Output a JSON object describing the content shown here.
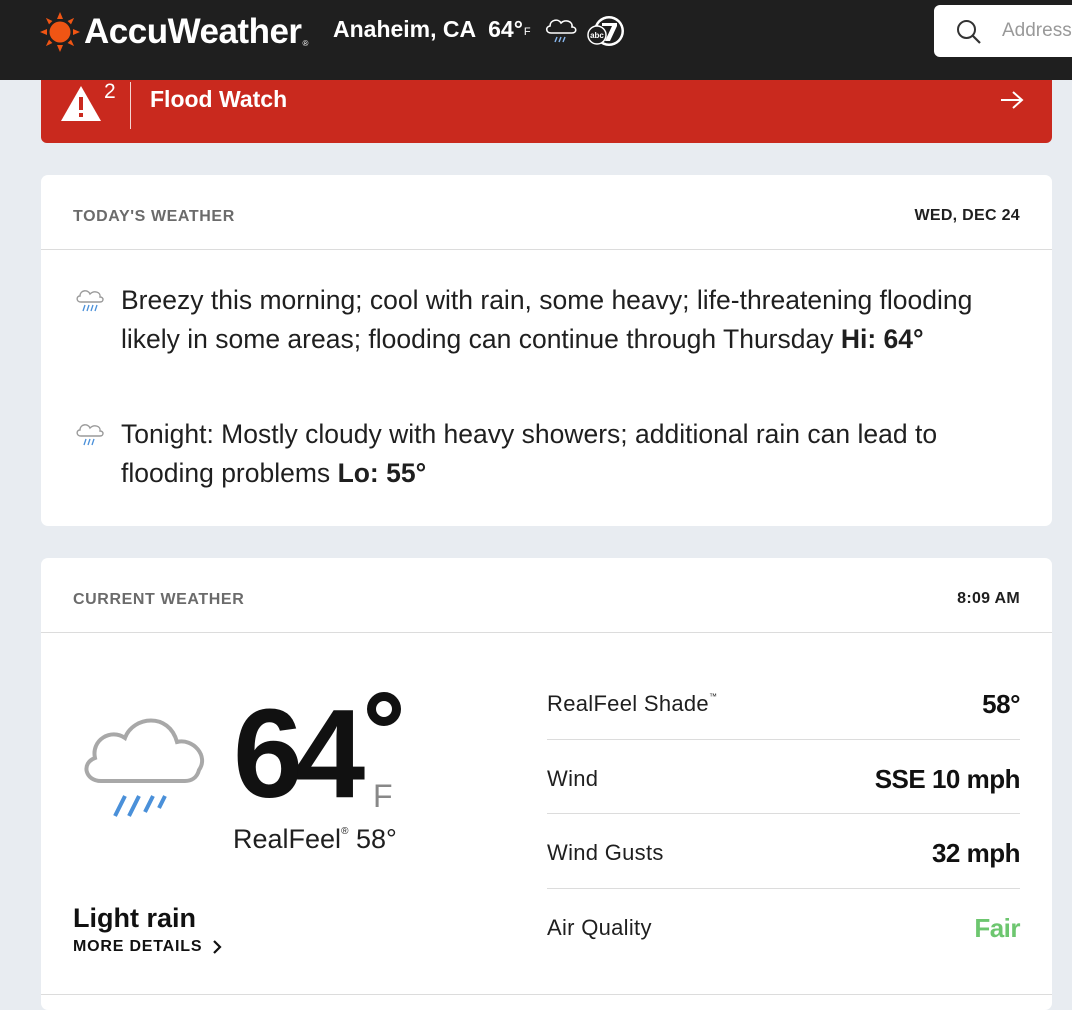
{
  "header": {
    "brand": "AccuWeather",
    "location": "Anaheim, CA",
    "temp": "64°",
    "temp_unit": "F",
    "weather_icon": "rain-icon",
    "partner_logo": "abc7-logo",
    "search_placeholder": "Address"
  },
  "alert": {
    "count": "2",
    "title": "Flood Watch",
    "color": "#c9291e"
  },
  "today": {
    "header": "TODAY'S WEATHER",
    "date": "WED, DEC 24",
    "day": {
      "text": "Breezy this morning; cool with rain, some heavy; life-threatening flooding likely in some areas; flooding can continue through Thursday",
      "hi_label": "Hi: 64°"
    },
    "night": {
      "text": "Tonight: Mostly cloudy with heavy showers; additional rain can lead to flooding problems",
      "lo_label": "Lo: 55°"
    }
  },
  "current": {
    "header": "CURRENT WEATHER",
    "time": "8:09 AM",
    "temp": "64",
    "unit": "F",
    "realfeel_label": "RealFeel",
    "realfeel_mark": "®",
    "realfeel_value": "58°",
    "phrase": "Light rain",
    "more_details": "MORE DETAILS",
    "details": [
      {
        "label": "RealFeel Shade",
        "mark": "™",
        "value": "58°"
      },
      {
        "label": "Wind",
        "mark": "",
        "value": "SSE 10 mph"
      },
      {
        "label": "Wind Gusts",
        "mark": "",
        "value": "32 mph"
      },
      {
        "label": "Air Quality",
        "mark": "",
        "value": "Fair"
      }
    ],
    "air_quality_color": "#6dc66f"
  }
}
